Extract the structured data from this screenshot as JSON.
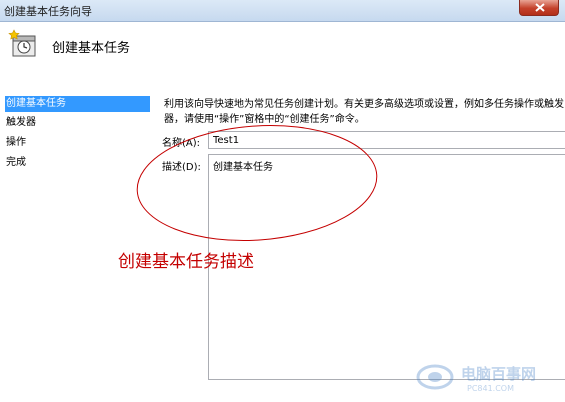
{
  "window": {
    "title": "创建基本任务向导"
  },
  "header": {
    "title": "创建基本任务"
  },
  "sidebar": {
    "items": [
      {
        "label": "创建基本任务",
        "active": true
      },
      {
        "label": "触发器",
        "active": false
      },
      {
        "label": "操作",
        "active": false
      },
      {
        "label": "完成",
        "active": false
      }
    ]
  },
  "main": {
    "description_line1": "利用该向导快速地为常见任务创建计划。有关更多高级选项或设置，例如多任务操作或触发",
    "description_line2": "器，请使用“操作”窗格中的“创建任务”命令。",
    "name_label": "名称(A):",
    "name_value": "Test1",
    "desc_label": "描述(D):",
    "desc_value": "创建基本任务"
  },
  "annotation": {
    "text": "创建基本任务描述",
    "color": "#c40000"
  },
  "watermark": {
    "text": "电脑百事网",
    "url": "PC841.COM"
  },
  "colors": {
    "selection": "#3399ff",
    "close_button": "#c4412b"
  }
}
